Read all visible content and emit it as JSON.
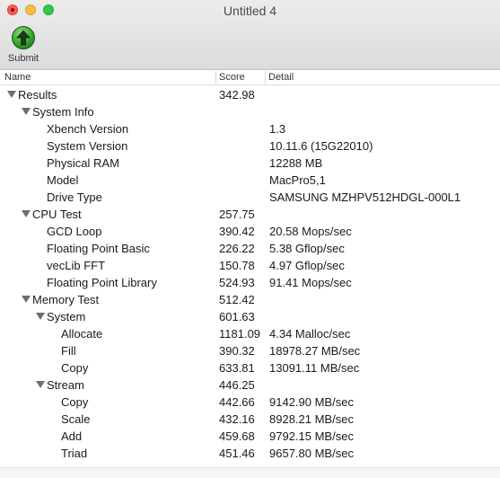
{
  "window": {
    "title": "Untitled 4"
  },
  "toolbar": {
    "submit_label": "Submit",
    "submit_icon": "upload-arrow-icon"
  },
  "table": {
    "columns": {
      "name": "Name",
      "score": "Score",
      "detail": "Detail"
    },
    "rows": [
      {
        "label": "Results",
        "score": "342.98",
        "detail": "",
        "level": 0,
        "expandable": true
      },
      {
        "label": "System Info",
        "score": "",
        "detail": "",
        "level": 1,
        "expandable": true
      },
      {
        "label": "Xbench Version",
        "score": "",
        "detail": "1.3",
        "level": 2,
        "expandable": false
      },
      {
        "label": "System Version",
        "score": "",
        "detail": "10.11.6 (15G22010)",
        "level": 2,
        "expandable": false
      },
      {
        "label": "Physical RAM",
        "score": "",
        "detail": "12288 MB",
        "level": 2,
        "expandable": false
      },
      {
        "label": "Model",
        "score": "",
        "detail": "MacPro5,1",
        "level": 2,
        "expandable": false
      },
      {
        "label": "Drive Type",
        "score": "",
        "detail": "SAMSUNG MZHPV512HDGL-000L1",
        "level": 2,
        "expandable": false
      },
      {
        "label": "CPU Test",
        "score": "257.75",
        "detail": "",
        "level": 1,
        "expandable": true
      },
      {
        "label": "GCD Loop",
        "score": "390.42",
        "detail": "20.58 Mops/sec",
        "level": 2,
        "expandable": false
      },
      {
        "label": "Floating Point Basic",
        "score": "226.22",
        "detail": "5.38 Gflop/sec",
        "level": 2,
        "expandable": false
      },
      {
        "label": "vecLib FFT",
        "score": "150.78",
        "detail": "4.97 Gflop/sec",
        "level": 2,
        "expandable": false
      },
      {
        "label": "Floating Point Library",
        "score": "524.93",
        "detail": "91.41 Mops/sec",
        "level": 2,
        "expandable": false
      },
      {
        "label": "Memory Test",
        "score": "512.42",
        "detail": "",
        "level": 1,
        "expandable": true
      },
      {
        "label": "System",
        "score": "601.63",
        "detail": "",
        "level": 2,
        "expandable": true
      },
      {
        "label": "Allocate",
        "score": "1181.09",
        "detail": "4.34 Malloc/sec",
        "level": 3,
        "expandable": false
      },
      {
        "label": "Fill",
        "score": "390.32",
        "detail": "18978.27 MB/sec",
        "level": 3,
        "expandable": false
      },
      {
        "label": "Copy",
        "score": "633.81",
        "detail": "13091.11 MB/sec",
        "level": 3,
        "expandable": false
      },
      {
        "label": "Stream",
        "score": "446.25",
        "detail": "",
        "level": 2,
        "expandable": true
      },
      {
        "label": "Copy",
        "score": "442.66",
        "detail": "9142.90 MB/sec",
        "level": 3,
        "expandable": false
      },
      {
        "label": "Scale",
        "score": "432.16",
        "detail": "8928.21 MB/sec",
        "level": 3,
        "expandable": false
      },
      {
        "label": "Add",
        "score": "459.68",
        "detail": "9792.15 MB/sec",
        "level": 3,
        "expandable": false
      },
      {
        "label": "Triad",
        "score": "451.46",
        "detail": "9657.80 MB/sec",
        "level": 3,
        "expandable": false
      }
    ]
  },
  "colors": {
    "close": "#fc5753",
    "minimize": "#fdbc40",
    "maximize": "#33c748",
    "submit_icon": "#2f9a2a"
  }
}
